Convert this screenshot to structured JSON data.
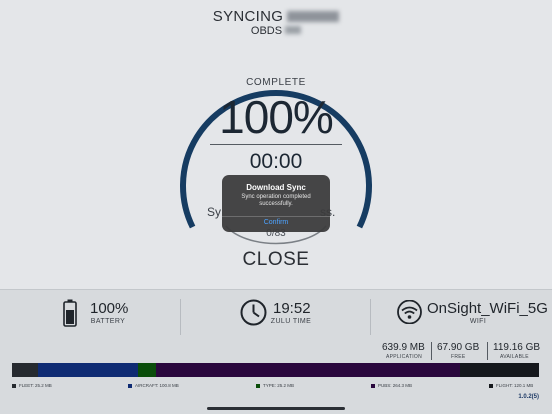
{
  "header": {
    "title": "SYNCING",
    "subtitle": "OBDS"
  },
  "progress": {
    "complete_label": "COMPLETE",
    "percent_text": "100%",
    "fraction": 1.0,
    "timer": "00:00",
    "status_left": "Sy",
    "status_right": "ss.",
    "count": "0/83",
    "close_label": "CLOSE"
  },
  "dialog": {
    "title": "Download Sync",
    "message": "Sync operation completed successfully.",
    "confirm_label": "Confirm"
  },
  "info": {
    "battery": {
      "value": "100%",
      "label": "BATTERY",
      "icon": "battery-icon"
    },
    "time": {
      "value": "19:52",
      "label": "ZULU TIME",
      "icon": "clock-icon"
    },
    "wifi": {
      "value": "OnSight_WiFi_5G",
      "label": "WIFI",
      "icon": "wifi-icon"
    }
  },
  "storage": {
    "application": {
      "value": "639.9 MB",
      "label": "APPLICATION"
    },
    "free": {
      "value": "67.90 GB",
      "label": "FREE"
    },
    "available": {
      "value": "119.16 GB",
      "label": "AVAILABLE"
    },
    "segments": [
      {
        "name": "FLEET",
        "size": "25.2 MB",
        "legend": "FLEET: 25.2 MB",
        "share": 0.05,
        "color": "#262a2f"
      },
      {
        "name": "AIRCRAFT",
        "size": "100.8 MB",
        "legend": "AIRCRAFT: 100.8 MB",
        "share": 0.19,
        "color": "#0f2b73"
      },
      {
        "name": "TYPE",
        "size": "25.2 MB",
        "legend": "TYPE: 25.2 MB",
        "share": 0.035,
        "color": "#0a4d0a"
      },
      {
        "name": "PUBS",
        "size": "264.3 MB",
        "legend": "PUBS: 264.3 MB",
        "share": 0.575,
        "color": "#2a083d"
      },
      {
        "name": "FLIGHT",
        "size": "120.1 MB",
        "legend": "FLIGHT: 120.1 MB",
        "share": 0.15,
        "color": "#15181c"
      }
    ]
  },
  "version": "1.0.2(5)",
  "colors": {
    "gauge_ring": "#163c62",
    "accent_link": "#4da3ff",
    "background": "#e4e6e9"
  }
}
